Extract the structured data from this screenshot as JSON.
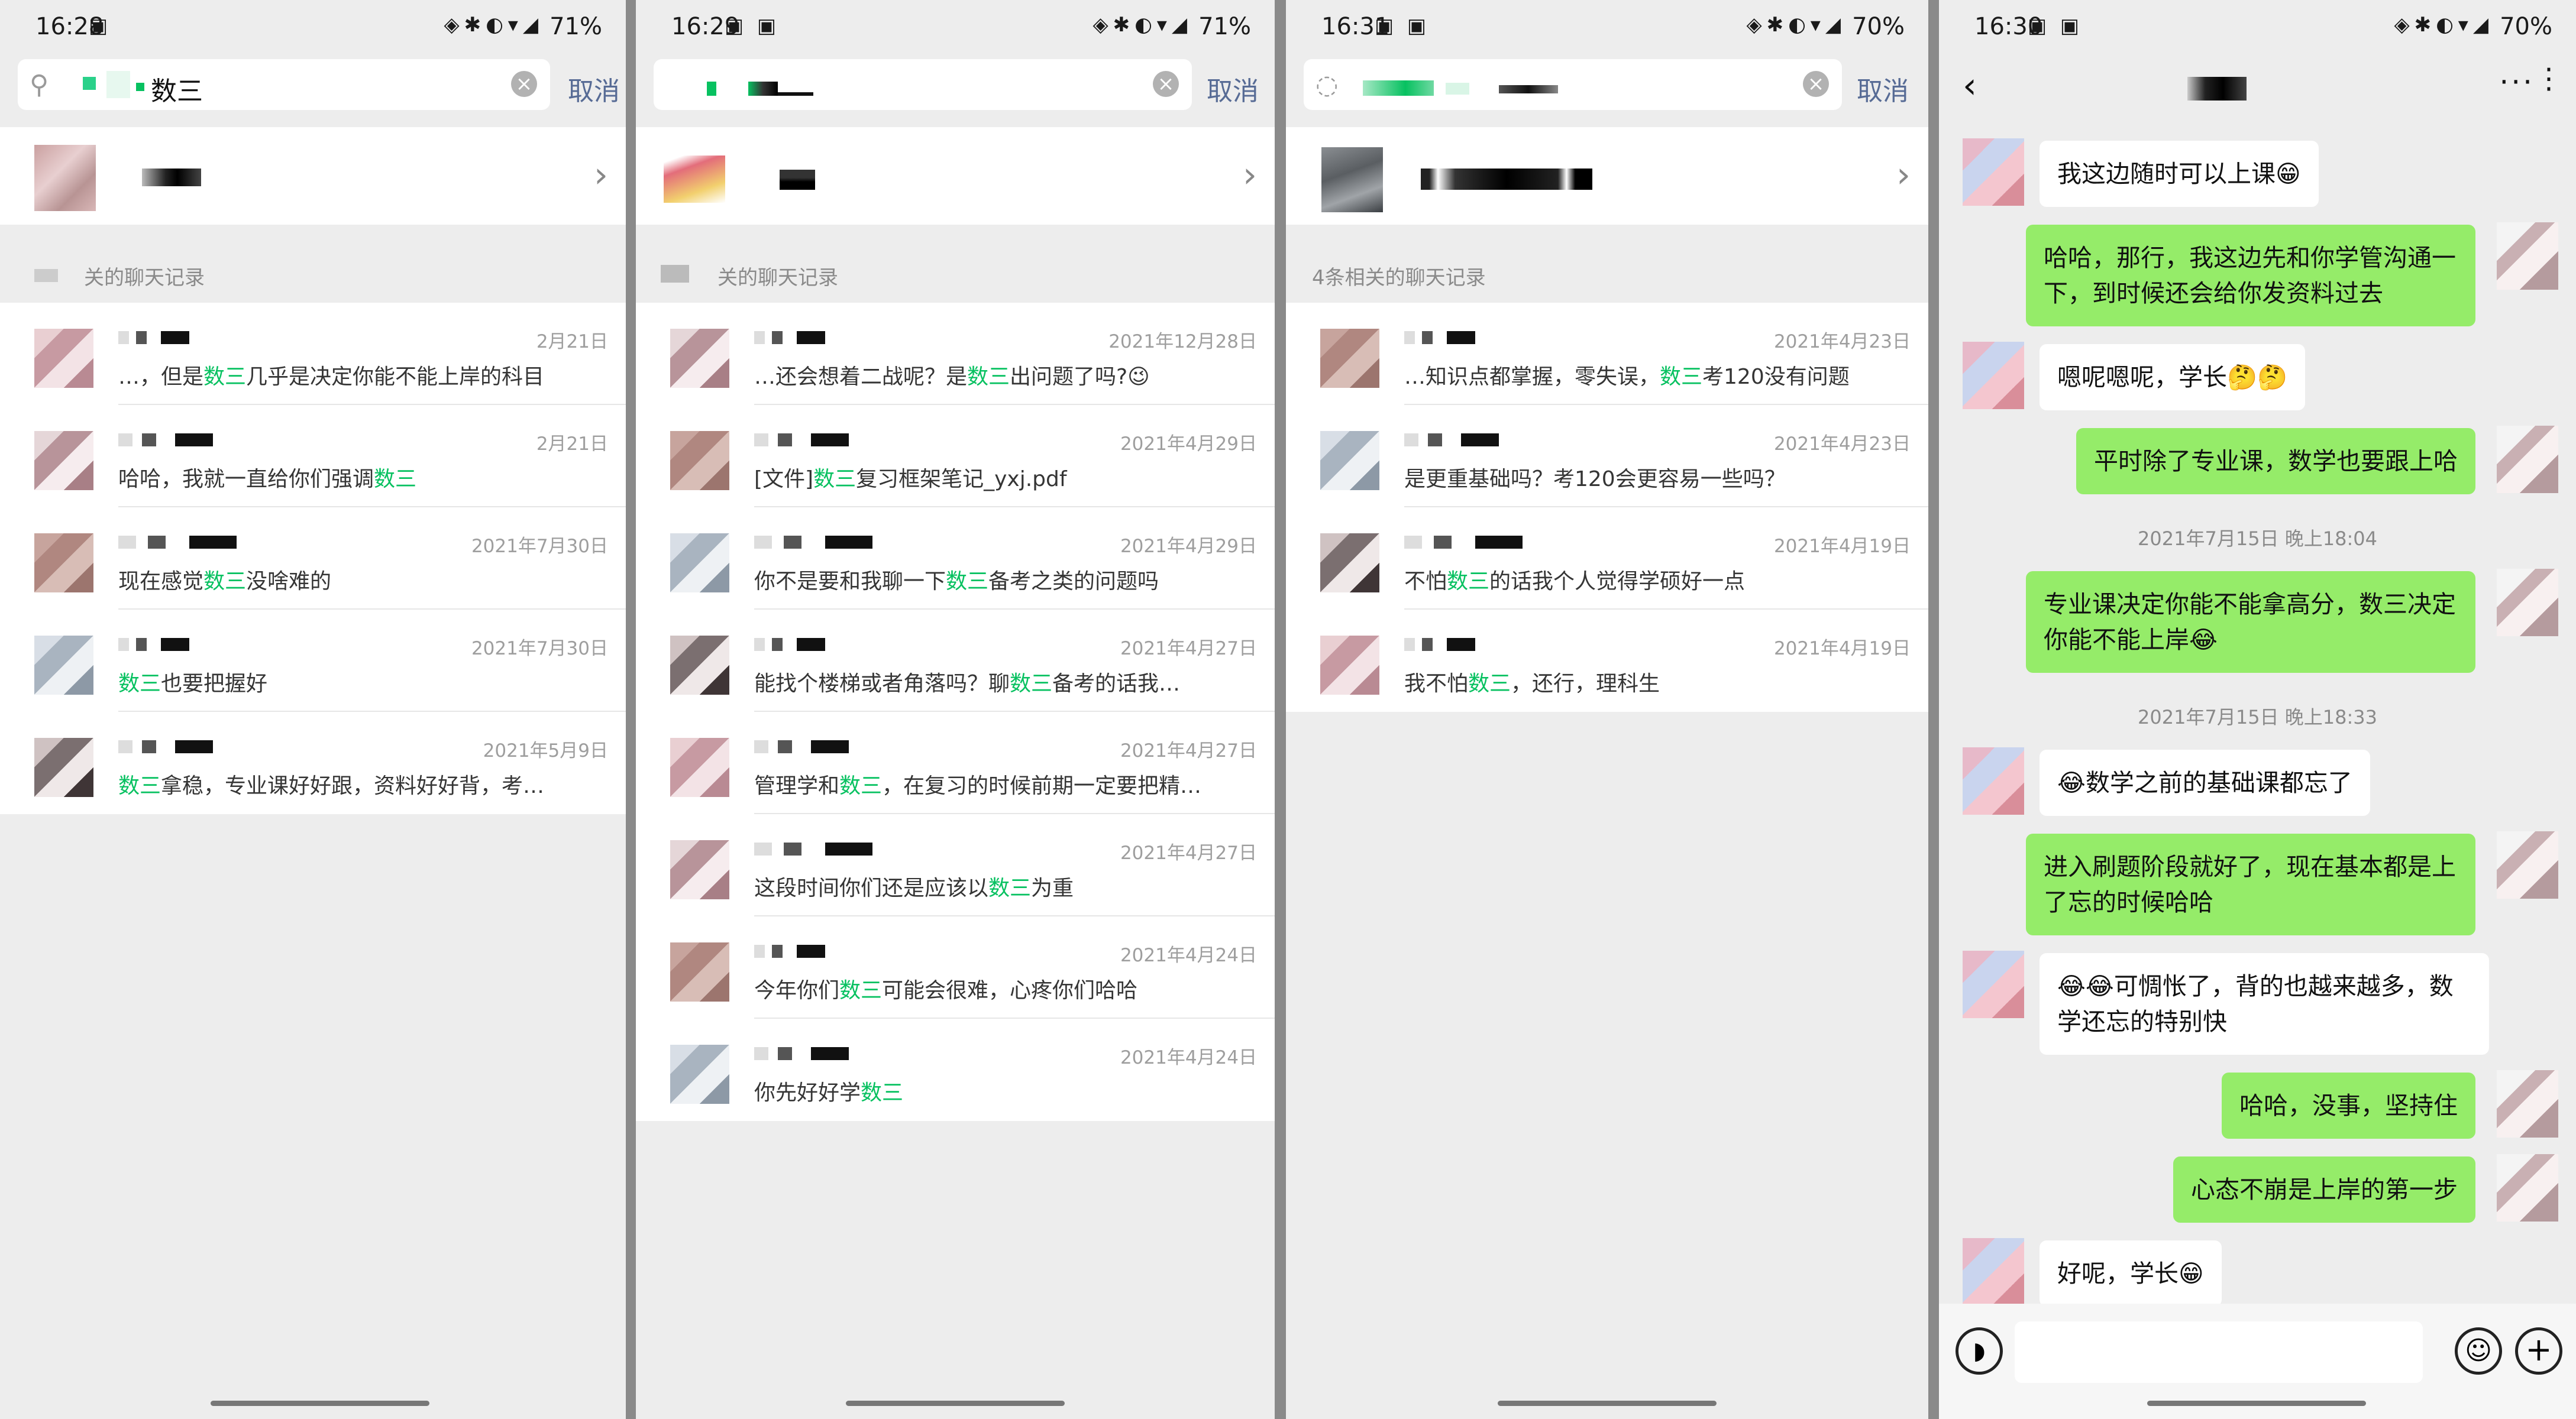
{
  "panels": [
    {
      "time": "16:28",
      "battery": "71%",
      "search_text": "数三",
      "cancel": "取消",
      "section_label": "关的聊天记录",
      "results": [
        {
          "date": "2月21日",
          "pre": "…，但是",
          "kw": "数三",
          "post": "几乎是决定你能不能上岸的科目"
        },
        {
          "date": "2月21日",
          "pre": "哈哈，我就一直给你们强调",
          "kw": "数三",
          "post": ""
        },
        {
          "date": "2021年7月30日",
          "pre": "现在感觉",
          "kw": "数三",
          "post": "没啥难的"
        },
        {
          "date": "2021年7月30日",
          "pre": "",
          "kw": "数三",
          "post": "也要把握好"
        },
        {
          "date": "2021年5月9日",
          "pre": "",
          "kw": "数三",
          "post": "拿稳，专业课好好跟，资料好好背，考…"
        }
      ]
    },
    {
      "time": "16:29",
      "battery": "71%",
      "search_text": "",
      "cancel": "取消",
      "section_label": "关的聊天记录",
      "results": [
        {
          "date": "2021年12月28日",
          "pre": "…还会想着二战呢？是",
          "kw": "数三",
          "post": "出问题了吗?😉"
        },
        {
          "date": "2021年4月29日",
          "pre": "[文件]",
          "kw": "数三",
          "post": "复习框架笔记_yxj.pdf"
        },
        {
          "date": "2021年4月29日",
          "pre": "你不是要和我聊一下",
          "kw": "数三",
          "post": "备考之类的问题吗"
        },
        {
          "date": "2021年4月27日",
          "pre": "能找个楼梯或者角落吗？聊",
          "kw": "数三",
          "post": "备考的话我…"
        },
        {
          "date": "2021年4月27日",
          "pre": "管理学和",
          "kw": "数三",
          "post": "，在复习的时候前期一定要把精…"
        },
        {
          "date": "2021年4月27日",
          "pre": "这段时间你们还是应该以",
          "kw": "数三",
          "post": "为重"
        },
        {
          "date": "2021年4月24日",
          "pre": "今年你们",
          "kw": "数三",
          "post": "可能会很难，心疼你们哈哈"
        },
        {
          "date": "2021年4月24日",
          "pre": "你先好好学",
          "kw": "数三",
          "post": ""
        }
      ]
    },
    {
      "time": "16:31",
      "battery": "70%",
      "search_text": "",
      "cancel": "取消",
      "section_label": "4条相关的聊天记录",
      "results": [
        {
          "date": "2021年4月23日",
          "pre": "…知识点都掌握，零失误，",
          "kw": "数三",
          "post": "考120没有问题"
        },
        {
          "date": "2021年4月23日",
          "pre": "",
          "kw": "",
          "post": "是更重基础吗？考120会更容易一些吗？"
        },
        {
          "date": "2021年4月19日",
          "pre": "不怕",
          "kw": "数三",
          "post": "的话我个人觉得学硕好一点"
        },
        {
          "date": "2021年4月19日",
          "pre": "我不怕",
          "kw": "数三",
          "post": "，还行，理科生"
        }
      ]
    }
  ],
  "chat": {
    "time": "16:30",
    "battery": "70%",
    "back_icon": "back-arrow-icon",
    "more": "···",
    "messages": [
      {
        "side": "left",
        "text": "我这边随时可以上课😁"
      },
      {
        "side": "right",
        "text": "哈哈，那行，我这边先和你学管沟通一下，到时候还会给你发资料过去"
      },
      {
        "side": "left",
        "text": "嗯呢嗯呢，学长🤔🤔"
      },
      {
        "side": "right",
        "text": "平时除了专业课，数学也要跟上哈"
      },
      {
        "side": "time",
        "text": "2021年7月15日 晚上18:04"
      },
      {
        "side": "right",
        "text": "专业课决定你能不能拿高分，数三决定你能不能上岸😂"
      },
      {
        "side": "time",
        "text": "2021年7月15日 晚上18:33"
      },
      {
        "side": "left",
        "text": "😂数学之前的基础课都忘了"
      },
      {
        "side": "right",
        "text": "进入刷题阶段就好了，现在基本都是上了忘的时候哈哈"
      },
      {
        "side": "left",
        "text": "😂😂可惆怅了，背的也越来越多，数学还忘的特别快"
      },
      {
        "side": "right",
        "text": "哈哈，没事，坚持住"
      },
      {
        "side": "right",
        "text": "心态不崩是上岸的第一步"
      },
      {
        "side": "left",
        "text": "好呢，学长😁"
      }
    ]
  },
  "colors": {
    "accent": "#07c160",
    "bubble_right": "#95ec69",
    "link": "#576b95"
  }
}
